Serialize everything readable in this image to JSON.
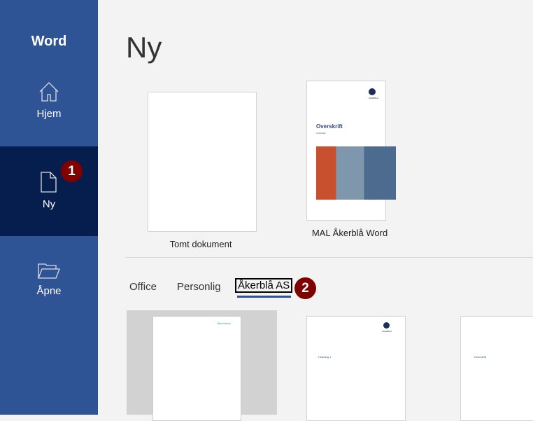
{
  "sidebar": {
    "app_name": "Word",
    "items": [
      {
        "label": "Hjem",
        "icon": "home-icon"
      },
      {
        "label": "Ny",
        "icon": "document-icon"
      },
      {
        "label": "Åpne",
        "icon": "folder-open-icon"
      }
    ]
  },
  "badges": {
    "one": "1",
    "two": "2"
  },
  "main": {
    "title": "Ny",
    "featured": [
      {
        "label": "Tomt dokument"
      },
      {
        "label": "MAL Åkerblå Word",
        "heading": "Overskrift",
        "subheading": "Undertittel",
        "logo_text": "ÅKERBLÅ"
      }
    ],
    "tabs": [
      {
        "label": "Office"
      },
      {
        "label": "Personlig"
      },
      {
        "label": "Åkerblå AS"
      }
    ],
    "templates": [
      {
        "logo_text": "ÅkerVanzo"
      },
      {
        "logo_text": "ÅKERBLÅ",
        "heading": "Heading 1"
      },
      {
        "heading": "Overskrift"
      }
    ]
  },
  "colors": {
    "sidebar": "#2f5496",
    "active": "#061e4d",
    "badge": "#800000"
  }
}
